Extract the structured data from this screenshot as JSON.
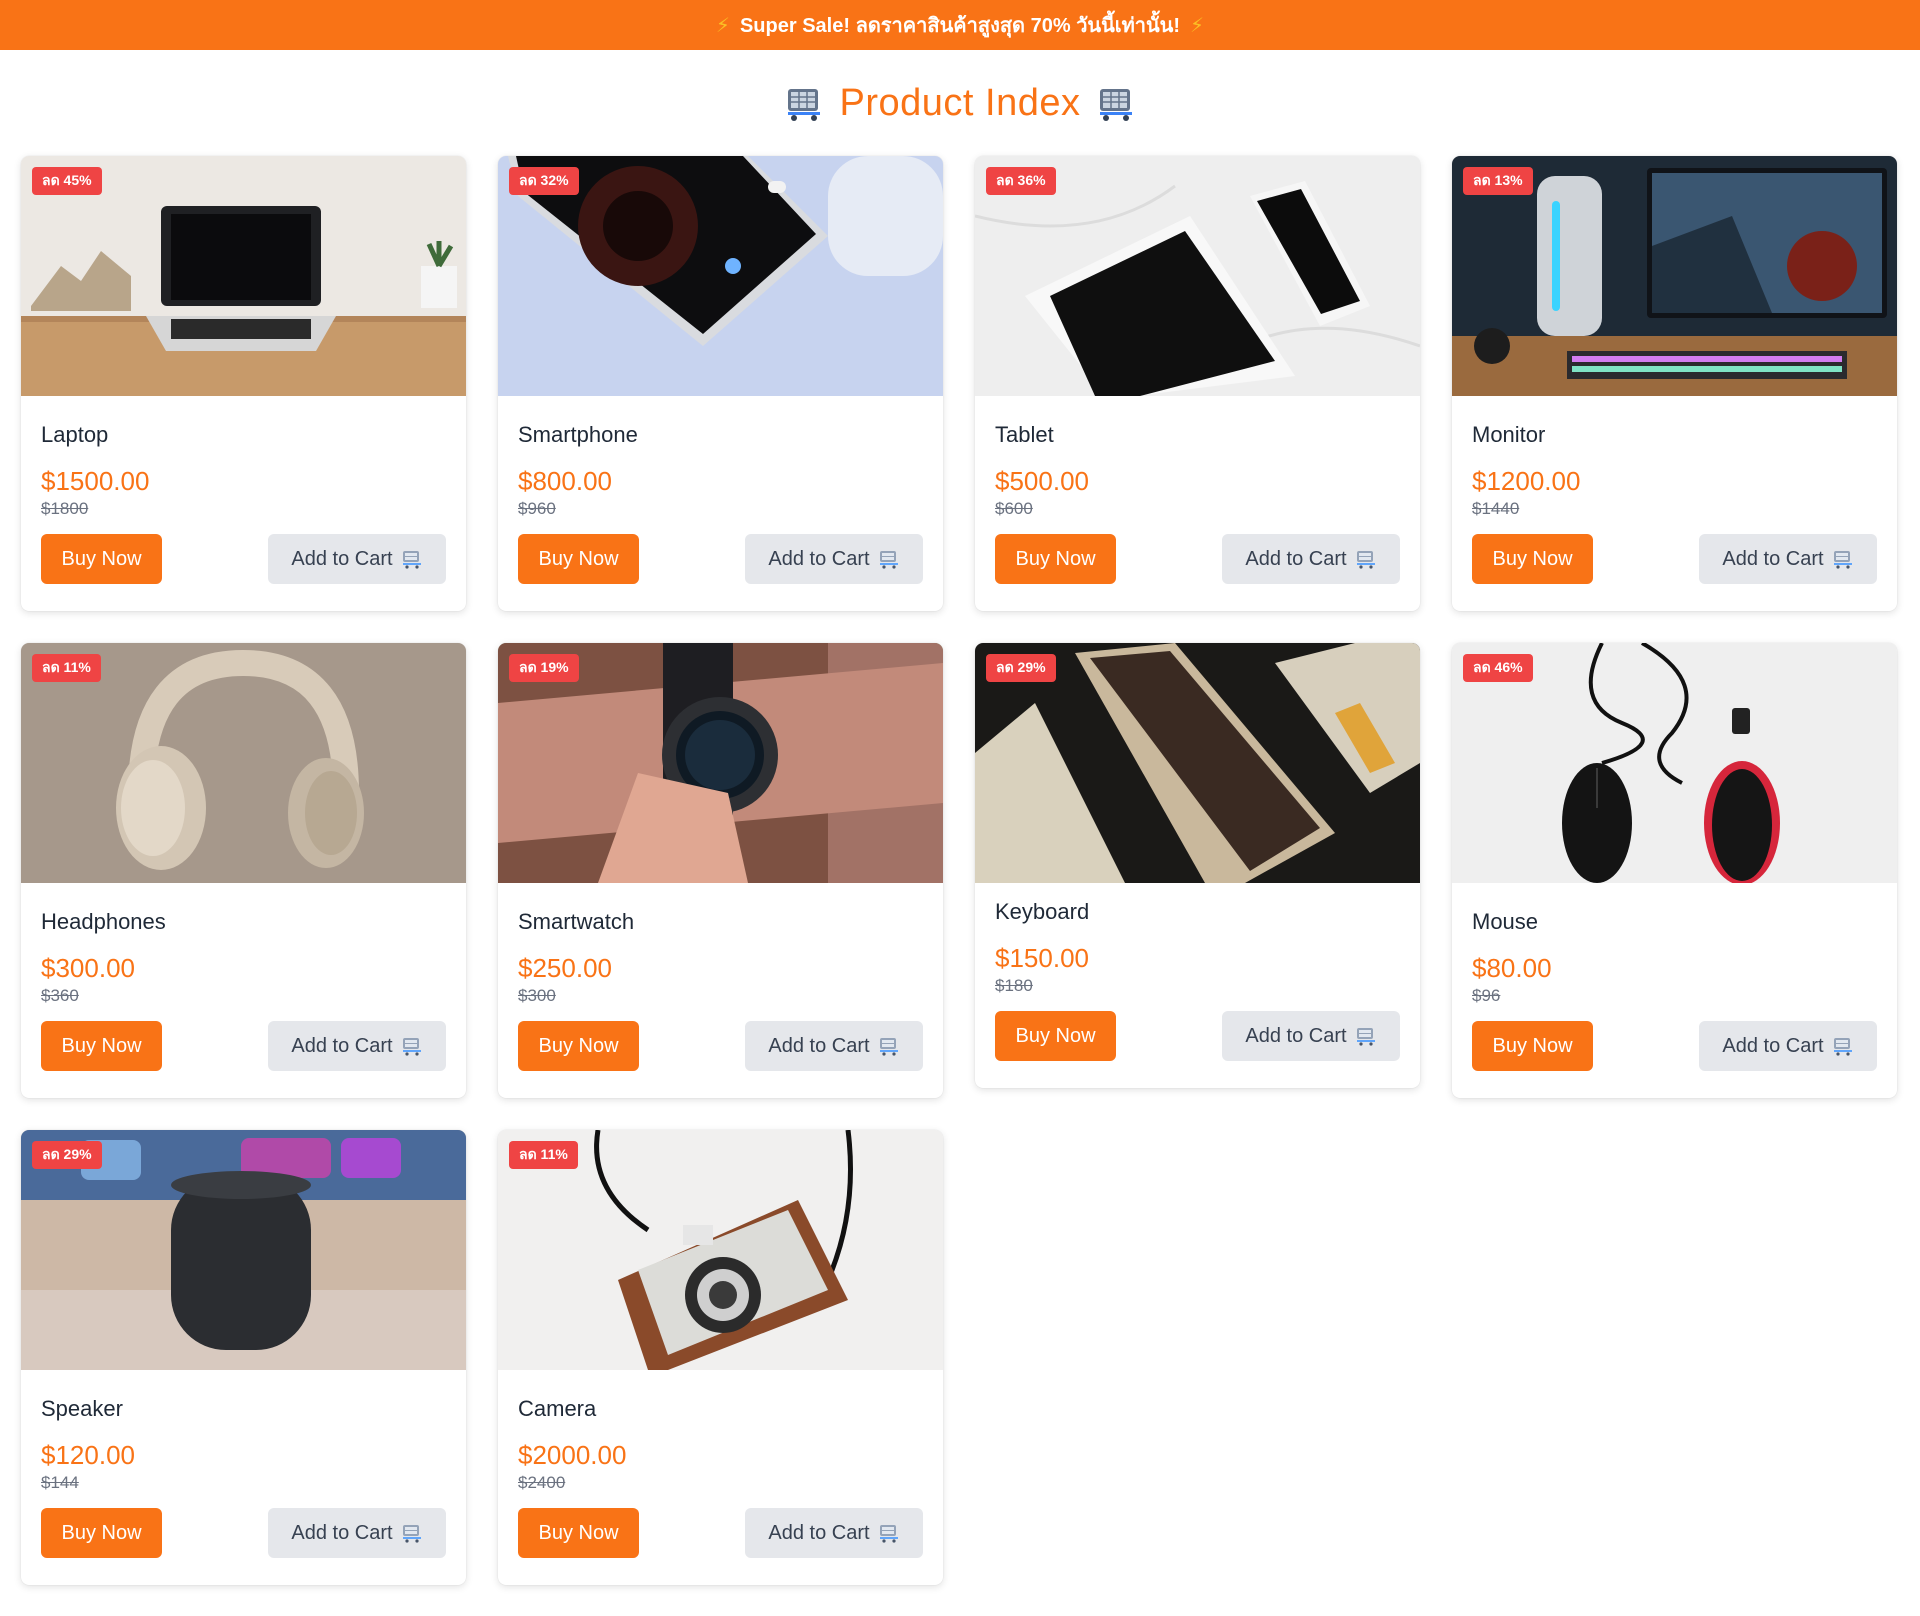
{
  "banner": {
    "text": "Super Sale! ลดราคาสินค้าสูงสุด 70% วันนี้เท่านั้น!",
    "icon": "lightning-icon"
  },
  "page": {
    "title": "Product Index",
    "title_icon": "shopping-cart-icon"
  },
  "colors": {
    "accent": "#f97316",
    "badge": "#ef4444",
    "secondary_button": "#e5e7eb"
  },
  "labels": {
    "buy_now": "Buy Now",
    "add_to_cart": "Add to Cart"
  },
  "products": [
    {
      "name": "Laptop",
      "price": "$1500.00",
      "old_price": "$1800",
      "badge": "ลด 45%",
      "image": "laptop-image"
    },
    {
      "name": "Smartphone",
      "price": "$800.00",
      "old_price": "$960",
      "badge": "ลด 32%",
      "image": "smartphone-image"
    },
    {
      "name": "Tablet",
      "price": "$500.00",
      "old_price": "$600",
      "badge": "ลด 36%",
      "image": "tablet-image"
    },
    {
      "name": "Monitor",
      "price": "$1200.00",
      "old_price": "$1440",
      "badge": "ลด 13%",
      "image": "monitor-image"
    },
    {
      "name": "Headphones",
      "price": "$300.00",
      "old_price": "$360",
      "badge": "ลด 11%",
      "image": "headphones-image"
    },
    {
      "name": "Smartwatch",
      "price": "$250.00",
      "old_price": "$300",
      "badge": "ลด 19%",
      "image": "smartwatch-image"
    },
    {
      "name": "Keyboard",
      "price": "$150.00",
      "old_price": "$180",
      "badge": "ลด 29%",
      "image": "keyboard-image"
    },
    {
      "name": "Mouse",
      "price": "$80.00",
      "old_price": "$96",
      "badge": "ลด 46%",
      "image": "mouse-image"
    },
    {
      "name": "Speaker",
      "price": "$120.00",
      "old_price": "$144",
      "badge": "ลด 29%",
      "image": "speaker-image"
    },
    {
      "name": "Camera",
      "price": "$2000.00",
      "old_price": "$2400",
      "badge": "ลด 11%",
      "image": "camera-image"
    }
  ]
}
